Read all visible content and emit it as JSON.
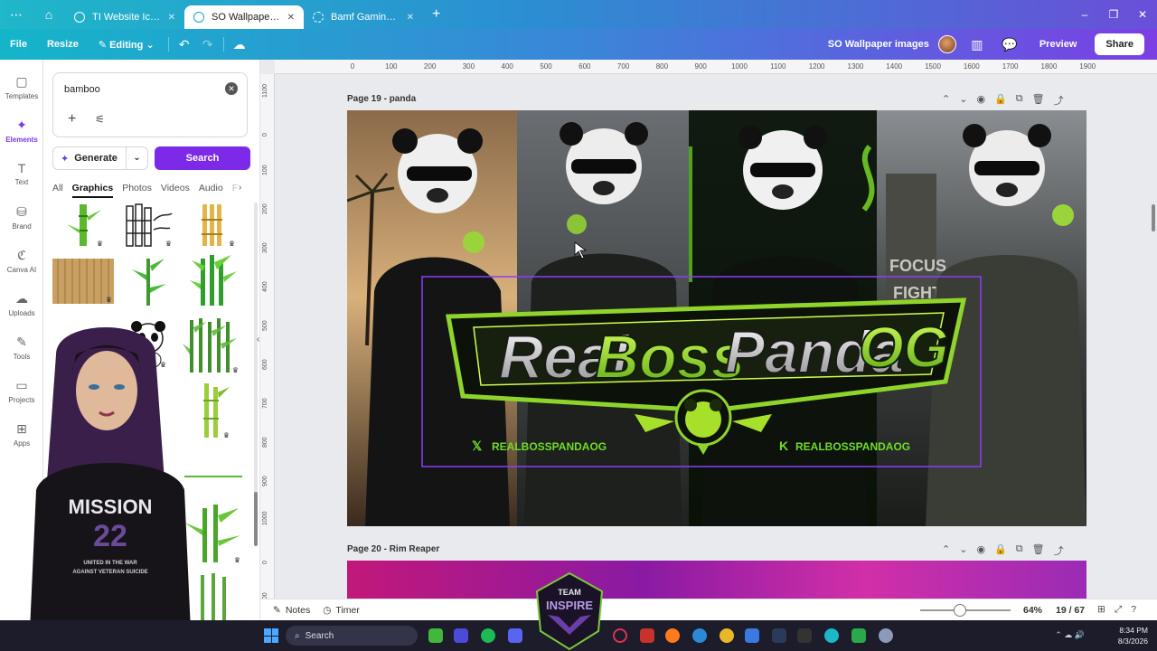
{
  "browser": {
    "tabs": [
      {
        "title": "TI Website Icons - ...",
        "active": false
      },
      {
        "title": "SO Wallpaper imag...",
        "active": true
      },
      {
        "title": "Bamf Gaming stuff ...",
        "active": false
      }
    ],
    "new_tab": "+",
    "window_controls": [
      "–",
      "❐",
      "✕"
    ]
  },
  "header": {
    "file": "File",
    "resize": "Resize",
    "editing": "Editing",
    "design_title": "SO Wallpaper images",
    "preview": "Preview",
    "share": "Share"
  },
  "rail": [
    {
      "label": "Templates",
      "icon": "templates-icon",
      "glyph": "▢"
    },
    {
      "label": "Elements",
      "icon": "elements-icon",
      "glyph": "✦",
      "active": true
    },
    {
      "label": "Text",
      "icon": "text-icon",
      "glyph": "T"
    },
    {
      "label": "Brand",
      "icon": "brand-icon",
      "glyph": "⛁"
    },
    {
      "label": "Canva AI",
      "icon": "canva-ai-icon",
      "glyph": "ℭ"
    },
    {
      "label": "Uploads",
      "icon": "uploads-icon",
      "glyph": "☁"
    },
    {
      "label": "Tools",
      "icon": "tools-icon",
      "glyph": "✎"
    },
    {
      "label": "Projects",
      "icon": "projects-icon",
      "glyph": "▭"
    },
    {
      "label": "Apps",
      "icon": "apps-icon",
      "glyph": "⊞"
    }
  ],
  "panel": {
    "search_value": "bamboo",
    "generate": "Generate",
    "search": "Search",
    "categories": [
      "All",
      "Graphics",
      "Photos",
      "Videos",
      "Audio",
      "F"
    ],
    "active_category": "Graphics"
  },
  "canvas": {
    "ruler_ticks": [
      "0",
      "100",
      "200",
      "300",
      "400",
      "500",
      "600",
      "700",
      "800",
      "900",
      "1000",
      "1100",
      "1200",
      "1300",
      "1400",
      "1500",
      "1600",
      "1700",
      "1800",
      "1900"
    ],
    "ruler_v_ticks": [
      "1100",
      "0",
      "100",
      "200",
      "300",
      "400",
      "500",
      "600",
      "700",
      "800",
      "900",
      "1000",
      "0",
      "100"
    ],
    "page1_label": "Page 19 - panda",
    "page2_label": "Page 20 - Rim Reaper",
    "banner": {
      "word1": "Real",
      "word2": "Boss",
      "word3": "Panda",
      "word4": "OG",
      "handle_left": "REALBOSSPANDAOG",
      "handle_right": "REALBOSSPANDAOG",
      "banner_text": "FOCUS",
      "banner_text2": "FIGHT"
    }
  },
  "footer": {
    "notes": "Notes",
    "timer": "Timer",
    "zoom": "64%",
    "pages": "19 / 67",
    "zoom_fraction": 0.44
  },
  "webcam": {
    "shirt_line1": "MISSION",
    "shirt_line2": "22",
    "shirt_line3": "UNITED IN THE WAR",
    "shirt_line4": "AGAINST VETERAN SUICIDE"
  },
  "taskbar": {
    "search": "Search",
    "time": "8:34 PM",
    "date": "8/3/2026",
    "overlay_logo1": "TEAM",
    "overlay_logo2": "INSPIRE"
  }
}
